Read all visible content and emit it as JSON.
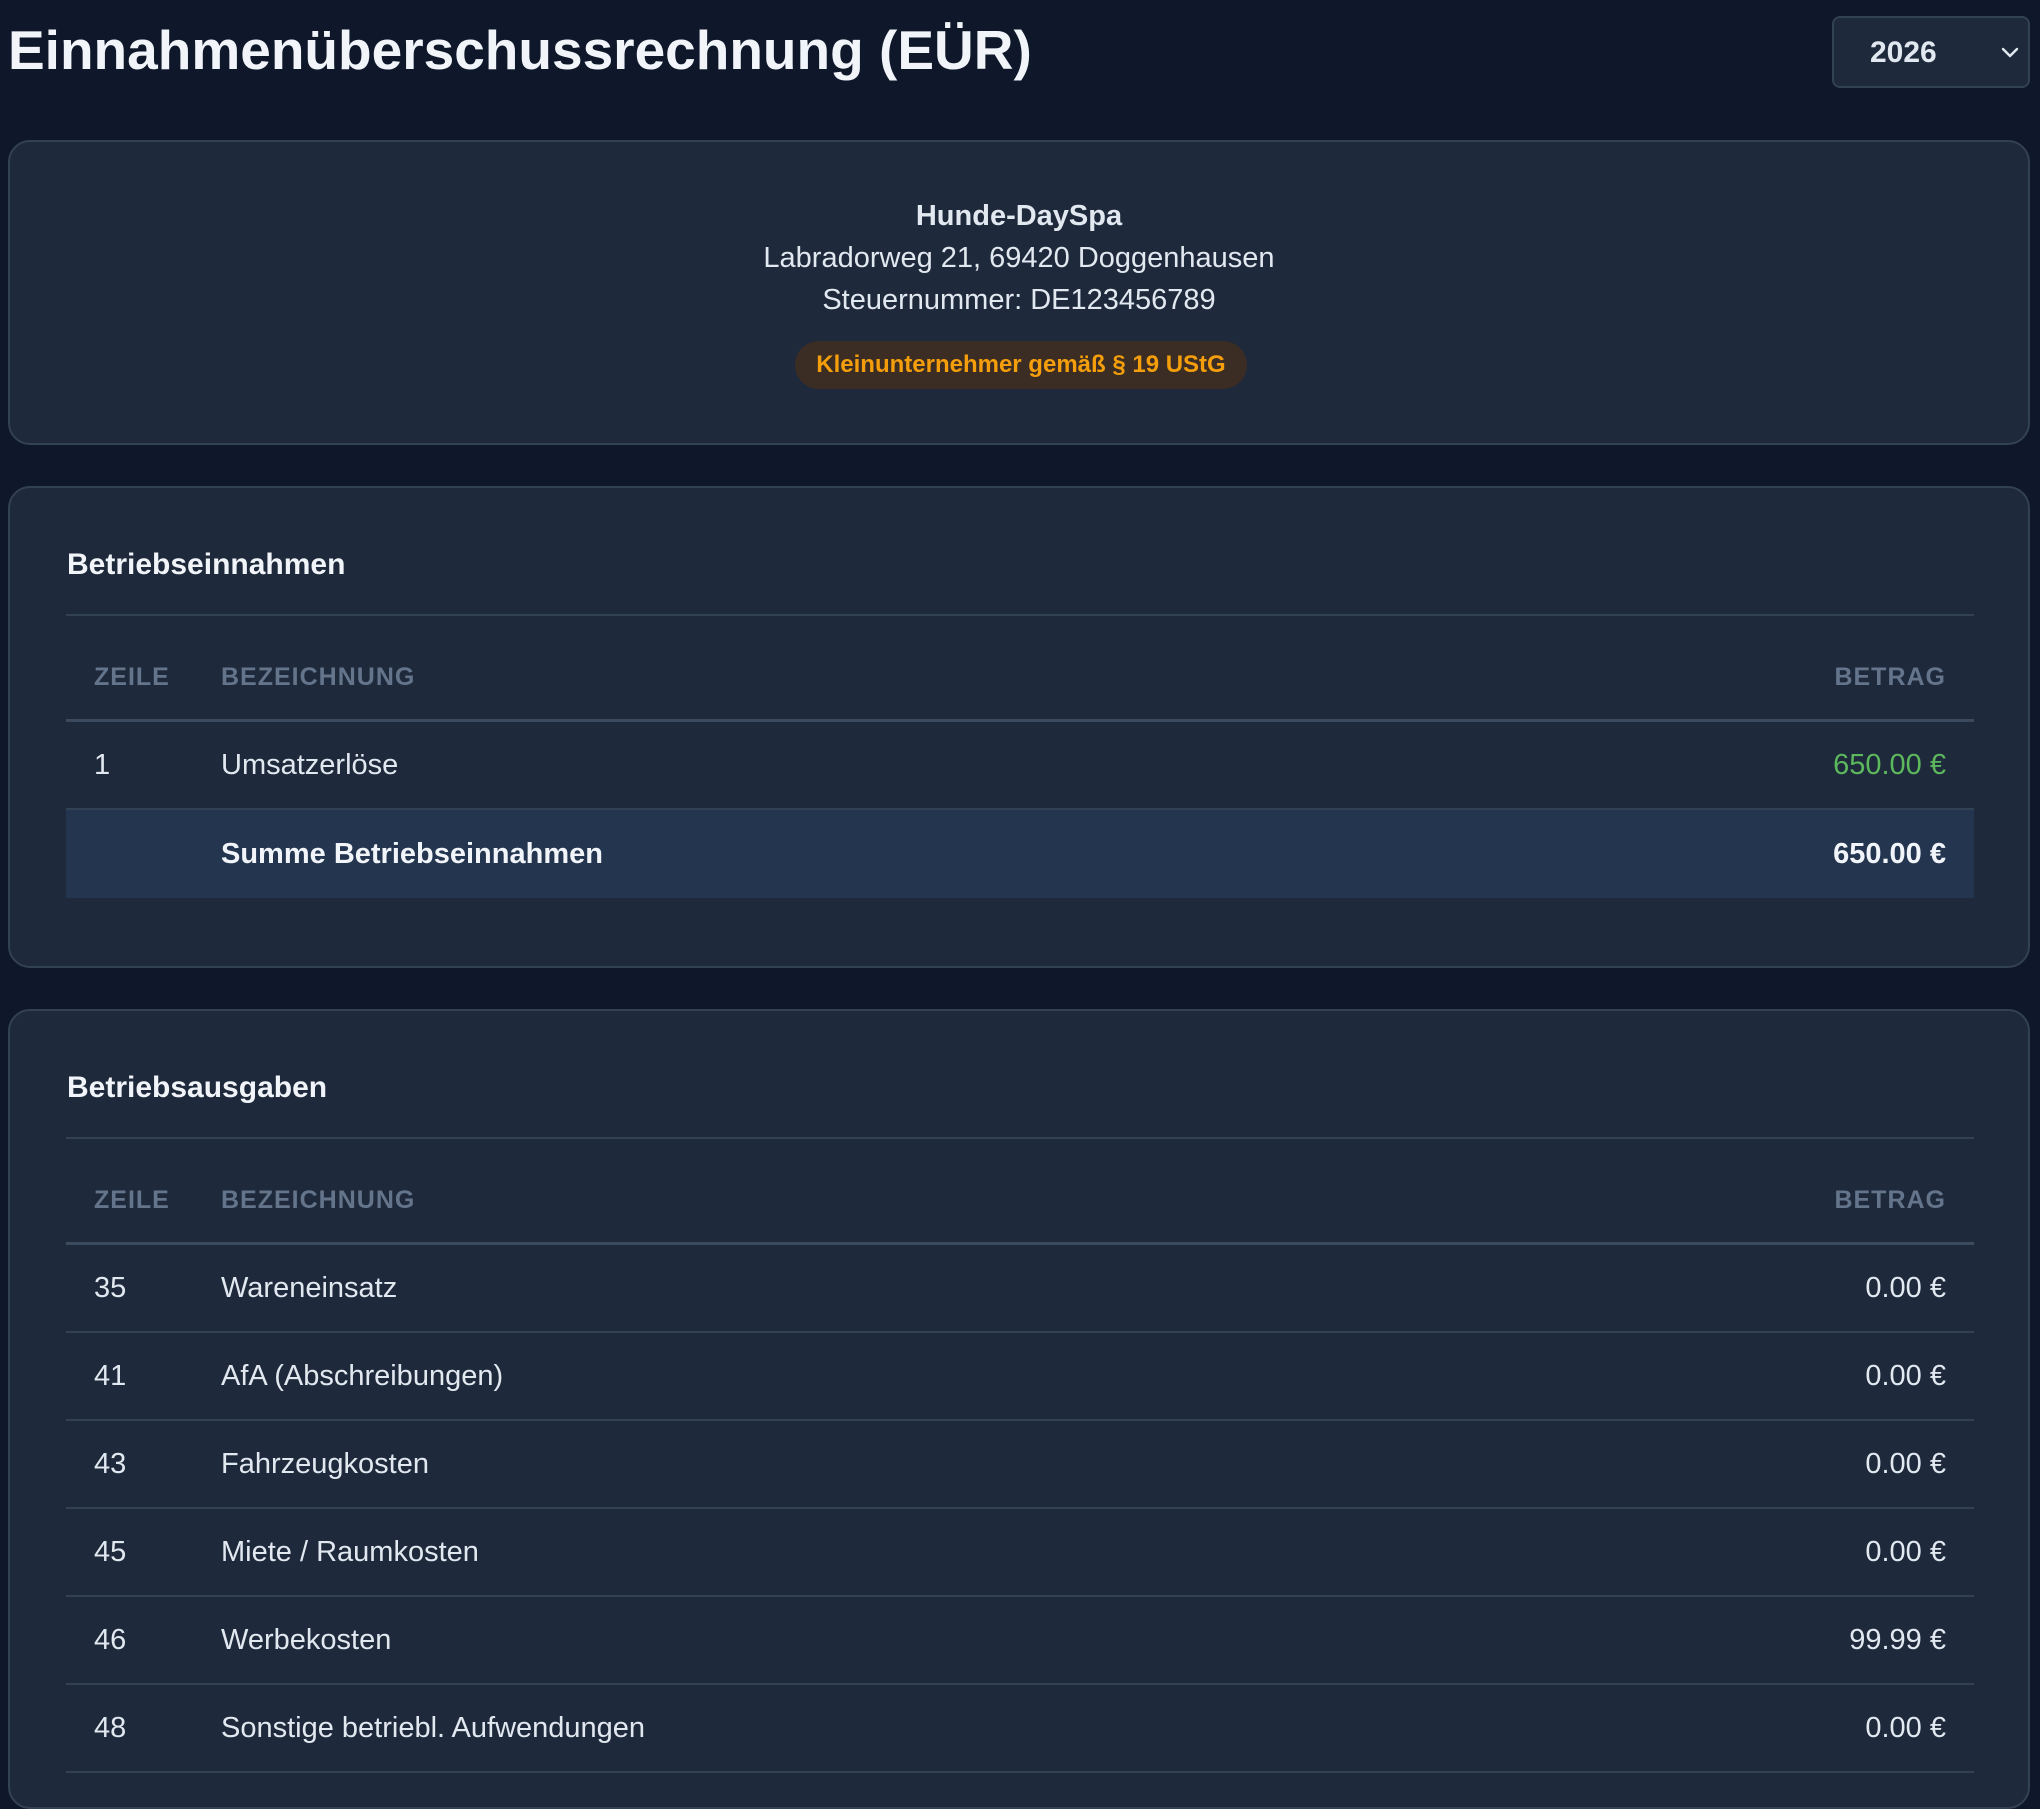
{
  "page": {
    "title": "Einnahmenüberschussrechnung (EÜR)",
    "year_select": {
      "value": "2026",
      "icon": "chevron-down-icon"
    }
  },
  "company": {
    "name": "Hunde-DaySpa",
    "address": "Labradorweg 21, 69420 Doggenhausen",
    "tax_id": "Steuernummer: DE123456789",
    "badge": "Kleinunternehmer gemäß § 19 UStG"
  },
  "income": {
    "title": "Betriebseinnahmen",
    "columns": {
      "line": "ZEILE",
      "description": "BEZEICHNUNG",
      "amount": "BETRAG"
    },
    "rows": [
      {
        "line": "1",
        "description": "Umsatzerlöse",
        "amount": "650.00 €"
      }
    ],
    "total": {
      "label": "Summe Betriebseinnahmen",
      "amount": "650.00 €"
    }
  },
  "expenses": {
    "title": "Betriebsausgaben",
    "columns": {
      "line": "ZEILE",
      "description": "BEZEICHNUNG",
      "amount": "BETRAG"
    },
    "rows": [
      {
        "line": "35",
        "description": "Wareneinsatz",
        "amount": "0.00 €"
      },
      {
        "line": "41",
        "description": "AfA (Abschreibungen)",
        "amount": "0.00 €"
      },
      {
        "line": "43",
        "description": "Fahrzeugkosten",
        "amount": "0.00 €"
      },
      {
        "line": "45",
        "description": "Miete / Raumkosten",
        "amount": "0.00 €"
      },
      {
        "line": "46",
        "description": "Werbekosten",
        "amount": "99.99 €"
      },
      {
        "line": "48",
        "description": "Sonstige betriebl. Aufwendungen",
        "amount": "0.00 €"
      }
    ]
  },
  "colors": {
    "background": "#0f172a",
    "card": "#1e293b",
    "border": "#334155",
    "positive_amount": "#5cb85c",
    "badge_text": "#f59e0b",
    "badge_bg": "#3b2d24",
    "total_row_bg": "#243550"
  }
}
